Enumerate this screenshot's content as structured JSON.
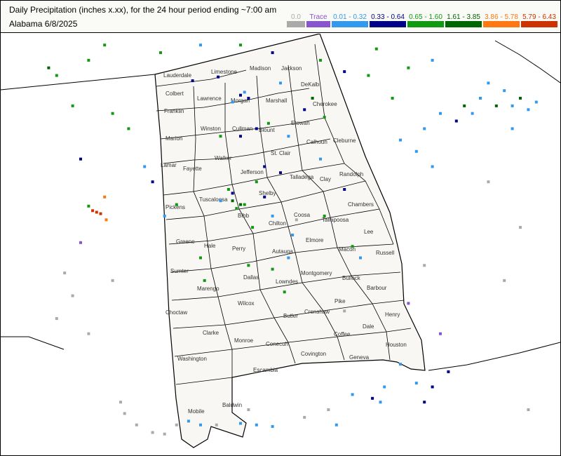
{
  "title": "Daily Precipitation (inches  x.xx),  for the 24 hour period ending ~7:00 am",
  "subtitle": "Alabama 6/8/2025",
  "legend": [
    {
      "label": "0.0",
      "color": "#aaaaaa"
    },
    {
      "label": "Trace",
      "color": "#8855cc"
    },
    {
      "label": "0.01 - 0.32",
      "color": "#3399ee"
    },
    {
      "label": "0.33 - 0.64",
      "color": "#000088"
    },
    {
      "label": "0.65 - 1.60",
      "color": "#119911"
    },
    {
      "label": "1.61 - 3.85",
      "color": "#006600"
    },
    {
      "label": "3.86 - 5.78",
      "color": "#ff7711"
    },
    {
      "label": "5.79 - 6.43",
      "color": "#cc3300"
    }
  ],
  "counties": [
    "Lauderdale",
    "Limestone",
    "Madison",
    "Jackson",
    "Colbert",
    "Lawrence",
    "Morgan",
    "Marshall",
    "DeKalb",
    "Franklin",
    "Cherokee",
    "Marion",
    "Winston",
    "Cullman",
    "Blount",
    "Etowah",
    "Calhoun",
    "Cleburne",
    "Lamar",
    "Fayette",
    "Walker",
    "St. Clair",
    "Jefferson",
    "Talladega",
    "Randolph",
    "Clay",
    "Pickens",
    "Tuscaloosa",
    "Shelby",
    "Chambers",
    "Bibb",
    "Coosa",
    "Tallapoosa",
    "Greene",
    "Hale",
    "Chilton",
    "Lee",
    "Perry",
    "Elmore",
    "Autauga",
    "Macon",
    "Russell",
    "Sumter",
    "Dallas",
    "Lowndes",
    "Montgomery",
    "Bullock",
    "Marengo",
    "Barbour",
    "Choctaw",
    "Wilcox",
    "Butler",
    "Crenshaw",
    "Pike",
    "Henry",
    "Clarke",
    "Monroe",
    "Dale",
    "Coffee",
    "Conecuh",
    "Houston",
    "Washington",
    "Covington",
    "Geneva",
    "Escambia",
    "Mobile",
    "Baldwin"
  ],
  "stations": [
    {
      "lon": -87.2,
      "lat": 34.93,
      "cat": 3
    },
    {
      "lon": -86.88,
      "lat": 34.98,
      "cat": 3
    },
    {
      "lon": -86.6,
      "lat": 34.74,
      "cat": 3
    },
    {
      "lon": -86.55,
      "lat": 34.78,
      "cat": 2
    },
    {
      "lon": -86.7,
      "lat": 34.65,
      "cat": 2
    },
    {
      "lon": -86.5,
      "lat": 34.7,
      "cat": 3
    },
    {
      "lon": -86.1,
      "lat": 34.9,
      "cat": 2
    },
    {
      "lon": -86.25,
      "lat": 34.37,
      "cat": 4
    },
    {
      "lon": -86.4,
      "lat": 34.3,
      "cat": 3
    },
    {
      "lon": -86.6,
      "lat": 34.2,
      "cat": 3
    },
    {
      "lon": -86.85,
      "lat": 34.2,
      "cat": 4
    },
    {
      "lon": -86.0,
      "lat": 34.2,
      "cat": 2
    },
    {
      "lon": -85.8,
      "lat": 34.55,
      "cat": 3
    },
    {
      "lon": -85.7,
      "lat": 34.7,
      "cat": 5
    },
    {
      "lon": -85.55,
      "lat": 34.45,
      "cat": 4
    },
    {
      "lon": -86.3,
      "lat": 33.8,
      "cat": 3
    },
    {
      "lon": -86.1,
      "lat": 33.72,
      "cat": 3
    },
    {
      "lon": -86.4,
      "lat": 33.6,
      "cat": 4
    },
    {
      "lon": -86.7,
      "lat": 33.45,
      "cat": 3
    },
    {
      "lon": -86.75,
      "lat": 33.5,
      "cat": 4
    },
    {
      "lon": -86.7,
      "lat": 33.35,
      "cat": 5
    },
    {
      "lon": -86.6,
      "lat": 33.3,
      "cat": 5
    },
    {
      "lon": -86.65,
      "lat": 33.25,
      "cat": 4
    },
    {
      "lon": -86.55,
      "lat": 33.3,
      "cat": 4
    },
    {
      "lon": -86.85,
      "lat": 33.35,
      "cat": 2
    },
    {
      "lon": -86.3,
      "lat": 33.4,
      "cat": 3
    },
    {
      "lon": -86.2,
      "lat": 33.15,
      "cat": 2
    },
    {
      "lon": -86.45,
      "lat": 33.0,
      "cat": 4
    },
    {
      "lon": -85.95,
      "lat": 32.9,
      "cat": 2
    },
    {
      "lon": -85.55,
      "lat": 33.15,
      "cat": 4
    },
    {
      "lon": -85.3,
      "lat": 33.5,
      "cat": 3
    },
    {
      "lon": -85.6,
      "lat": 33.9,
      "cat": 2
    },
    {
      "lon": -85.2,
      "lat": 32.75,
      "cat": 4
    },
    {
      "lon": -85.1,
      "lat": 32.6,
      "cat": 2
    },
    {
      "lon": -86.2,
      "lat": 32.45,
      "cat": 4
    },
    {
      "lon": -86.0,
      "lat": 32.6,
      "cat": 2
    },
    {
      "lon": -86.05,
      "lat": 32.15,
      "cat": 4
    },
    {
      "lon": -86.5,
      "lat": 32.5,
      "cat": 4
    },
    {
      "lon": -87.1,
      "lat": 32.6,
      "cat": 4
    },
    {
      "lon": -87.05,
      "lat": 32.3,
      "cat": 4
    },
    {
      "lon": -87.4,
      "lat": 33.3,
      "cat": 4
    },
    {
      "lon": -87.55,
      "lat": 33.15,
      "cat": 2
    },
    {
      "lon": -87.8,
      "lat": 33.8,
      "cat": 2
    },
    {
      "lon": -87.7,
      "lat": 33.6,
      "cat": 3
    },
    {
      "lon": -88.3,
      "lat": 33.4,
      "cat": 6
    },
    {
      "lon": -88.4,
      "lat": 33.2,
      "cat": 7
    },
    {
      "lon": -88.35,
      "lat": 33.18,
      "cat": 7
    },
    {
      "lon": -88.45,
      "lat": 33.22,
      "cat": 7
    },
    {
      "lon": -88.28,
      "lat": 33.1,
      "cat": 6
    },
    {
      "lon": -88.5,
      "lat": 33.28,
      "cat": 4
    },
    {
      "lon": -88.6,
      "lat": 32.8,
      "cat": 1
    },
    {
      "lon": -88.2,
      "lat": 32.3,
      "cat": 0
    },
    {
      "lon": -88.7,
      "lat": 32.1,
      "cat": 0
    },
    {
      "lon": -88.9,
      "lat": 31.8,
      "cat": 0
    },
    {
      "lon": -88.5,
      "lat": 31.6,
      "cat": 0
    },
    {
      "lon": -88.1,
      "lat": 30.7,
      "cat": 0
    },
    {
      "lon": -88.05,
      "lat": 30.55,
      "cat": 0
    },
    {
      "lon": -87.9,
      "lat": 30.4,
      "cat": 0
    },
    {
      "lon": -87.7,
      "lat": 30.3,
      "cat": 0
    },
    {
      "lon": -87.55,
      "lat": 30.28,
      "cat": 0
    },
    {
      "lon": -87.4,
      "lat": 30.4,
      "cat": 0
    },
    {
      "lon": -87.25,
      "lat": 30.45,
      "cat": 2
    },
    {
      "lon": -87.1,
      "lat": 30.4,
      "cat": 2
    },
    {
      "lon": -86.9,
      "lat": 30.4,
      "cat": 0
    },
    {
      "lon": -86.6,
      "lat": 30.42,
      "cat": 2
    },
    {
      "lon": -86.4,
      "lat": 30.4,
      "cat": 2
    },
    {
      "lon": -86.2,
      "lat": 30.38,
      "cat": 2
    },
    {
      "lon": -86.5,
      "lat": 30.6,
      "cat": 0
    },
    {
      "lon": -85.8,
      "lat": 30.5,
      "cat": 0
    },
    {
      "lon": -85.5,
      "lat": 30.6,
      "cat": 0
    },
    {
      "lon": -85.2,
      "lat": 30.8,
      "cat": 2
    },
    {
      "lon": -84.8,
      "lat": 30.9,
      "cat": 2
    },
    {
      "lon": -84.4,
      "lat": 30.95,
      "cat": 2
    },
    {
      "lon": -84.2,
      "lat": 30.9,
      "cat": 3
    },
    {
      "lon": -84.3,
      "lat": 30.7,
      "cat": 3
    },
    {
      "lon": -84.0,
      "lat": 31.1,
      "cat": 3
    },
    {
      "lon": -84.6,
      "lat": 31.2,
      "cat": 2
    },
    {
      "lon": -84.1,
      "lat": 31.6,
      "cat": 1
    },
    {
      "lon": -84.5,
      "lat": 32.0,
      "cat": 1
    },
    {
      "lon": -84.3,
      "lat": 32.5,
      "cat": 0
    },
    {
      "lon": -84.2,
      "lat": 33.8,
      "cat": 2
    },
    {
      "lon": -84.4,
      "lat": 34.0,
      "cat": 2
    },
    {
      "lon": -84.6,
      "lat": 34.15,
      "cat": 2
    },
    {
      "lon": -84.3,
      "lat": 34.3,
      "cat": 2
    },
    {
      "lon": -84.1,
      "lat": 34.5,
      "cat": 2
    },
    {
      "lon": -83.9,
      "lat": 34.4,
      "cat": 3
    },
    {
      "lon": -83.8,
      "lat": 34.6,
      "cat": 5
    },
    {
      "lon": -83.7,
      "lat": 34.5,
      "cat": 2
    },
    {
      "lon": -83.6,
      "lat": 34.7,
      "cat": 2
    },
    {
      "lon": -83.4,
      "lat": 34.6,
      "cat": 5
    },
    {
      "lon": -83.5,
      "lat": 34.9,
      "cat": 2
    },
    {
      "lon": -83.3,
      "lat": 34.8,
      "cat": 2
    },
    {
      "lon": -83.2,
      "lat": 34.6,
      "cat": 2
    },
    {
      "lon": -83.1,
      "lat": 34.7,
      "cat": 5
    },
    {
      "lon": -83.0,
      "lat": 34.55,
      "cat": 2
    },
    {
      "lon": -82.9,
      "lat": 34.65,
      "cat": 2
    },
    {
      "lon": -84.7,
      "lat": 34.7,
      "cat": 4
    },
    {
      "lon": -84.5,
      "lat": 35.1,
      "cat": 4
    },
    {
      "lon": -84.2,
      "lat": 35.2,
      "cat": 2
    },
    {
      "lon": -84.9,
      "lat": 35.35,
      "cat": 4
    },
    {
      "lon": -85.0,
      "lat": 35.0,
      "cat": 4
    },
    {
      "lon": -85.3,
      "lat": 35.05,
      "cat": 3
    },
    {
      "lon": -85.6,
      "lat": 35.2,
      "cat": 4
    },
    {
      "lon": -86.2,
      "lat": 35.3,
      "cat": 3
    },
    {
      "lon": -86.6,
      "lat": 35.4,
      "cat": 4
    },
    {
      "lon": -87.1,
      "lat": 35.4,
      "cat": 2
    },
    {
      "lon": -87.6,
      "lat": 35.3,
      "cat": 4
    },
    {
      "lon": -88.3,
      "lat": 35.4,
      "cat": 4
    },
    {
      "lon": -88.5,
      "lat": 35.2,
      "cat": 4
    },
    {
      "lon": -89.0,
      "lat": 35.1,
      "cat": 5
    },
    {
      "lon": -88.9,
      "lat": 35.0,
      "cat": 4
    },
    {
      "lon": -88.7,
      "lat": 34.6,
      "cat": 4
    },
    {
      "lon": -88.2,
      "lat": 34.5,
      "cat": 4
    },
    {
      "lon": -88.0,
      "lat": 34.3,
      "cat": 4
    },
    {
      "lon": -88.6,
      "lat": 33.9,
      "cat": 3
    },
    {
      "lon": -88.8,
      "lat": 32.4,
      "cat": 0
    },
    {
      "lon": -84.95,
      "lat": 30.75,
      "cat": 3
    },
    {
      "lon": -84.85,
      "lat": 30.7,
      "cat": 2
    },
    {
      "lon": -85.4,
      "lat": 30.4,
      "cat": 2
    },
    {
      "lon": -83.2,
      "lat": 34.3,
      "cat": 2
    },
    {
      "lon": -83.5,
      "lat": 33.6,
      "cat": 0
    },
    {
      "lon": -83.1,
      "lat": 33.0,
      "cat": 0
    },
    {
      "lon": -83.3,
      "lat": 32.3,
      "cat": 0
    },
    {
      "lon": -83.0,
      "lat": 30.6,
      "cat": 0
    },
    {
      "lon": -85.9,
      "lat": 33.1,
      "cat": 0
    },
    {
      "lon": -85.3,
      "lat": 31.9,
      "cat": 0
    }
  ]
}
